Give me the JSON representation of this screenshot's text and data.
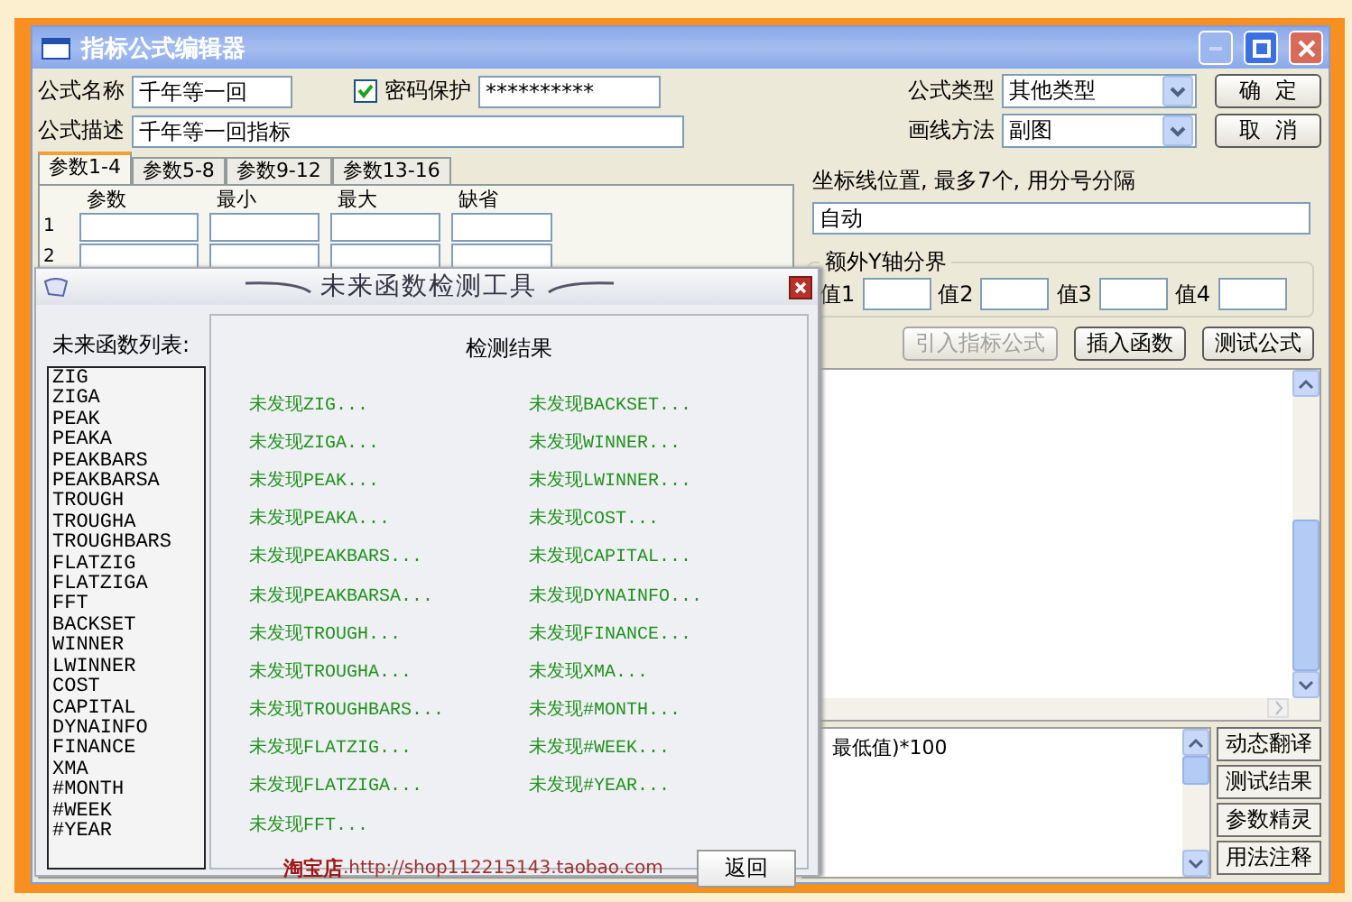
{
  "window": {
    "title": "指标公式编辑器"
  },
  "form": {
    "name_label": "公式名称",
    "name_value": "千年等一回",
    "password": {
      "checked": true,
      "label": "密码保护",
      "value": "**********"
    },
    "desc_label": "公式描述",
    "desc_value": "千年等一回指标",
    "type_label": "公式类型",
    "type_value": "其他类型",
    "draw_label": "画线方法",
    "draw_value": "副图"
  },
  "buttons": [
    "确  定",
    "取  消"
  ],
  "param_tabs": [
    {
      "label": "参数1-4",
      "selected": true
    },
    {
      "label": "参数5-8",
      "selected": false
    },
    {
      "label": "参数9-12",
      "selected": false
    },
    {
      "label": "参数13-16",
      "selected": false
    }
  ],
  "param_table": {
    "columns": [
      "参数",
      "最小",
      "最大",
      "缺省"
    ],
    "rows": [
      "1",
      "2"
    ]
  },
  "axis": {
    "label": "坐标线位置, 最多7个, 用分号分隔",
    "value": "自动"
  },
  "y_group": {
    "title": "额外Y轴分界",
    "fields": [
      "值1",
      "值2",
      "值3",
      "值4"
    ]
  },
  "tool_buttons": [
    {
      "label": "引入指标公式",
      "disabled": true
    },
    {
      "label": "插入函数",
      "disabled": false
    },
    {
      "label": "测试公式",
      "disabled": false
    }
  ],
  "comment_text": "最低值)*100",
  "side_buttons": [
    "动态翻译",
    "测试结果",
    "参数精灵",
    "用法注释"
  ],
  "dialog": {
    "title": "未来函数检测工具",
    "list_label": "未来函数列表:",
    "functions": [
      "ZIG",
      "ZIGA",
      "PEAK",
      "PEAKA",
      "PEAKBARS",
      "PEAKBARSA",
      "TROUGH",
      "TROUGHA",
      "TROUGHBARS",
      "FLATZIG",
      "FLATZIGA",
      "FFT",
      "BACKSET",
      "WINNER",
      "LWINNER",
      "COST",
      "CAPITAL",
      "DYNAINFO",
      "FINANCE",
      "XMA",
      "#MONTH",
      "#WEEK",
      "#YEAR"
    ],
    "results_title": "检测结果",
    "results": [
      "未发现ZIG...",
      "未发现ZIGA...",
      "未发现PEAK...",
      "未发现PEAKA...",
      "未发现PEAKBARS...",
      "未发现PEAKBARSA...",
      "未发现TROUGH...",
      "未发现TROUGHA...",
      "未发现TROUGHBARS...",
      "未发现FLATZIG...",
      "未发现FLATZIGA...",
      "未发现FFT...",
      "未发现BACKSET...",
      "未发现WINNER...",
      "未发现LWINNER...",
      "未发现COST...",
      "未发现CAPITAL...",
      "未发现DYNAINFO...",
      "未发现FINANCE...",
      "未发现XMA...",
      "未发现#MONTH...",
      "未发现#WEEK...",
      "未发现#YEAR..."
    ],
    "shop_label": "淘宝店",
    "shop_url": ".http://shop112215143.taobao.com",
    "back_button": "返回"
  }
}
